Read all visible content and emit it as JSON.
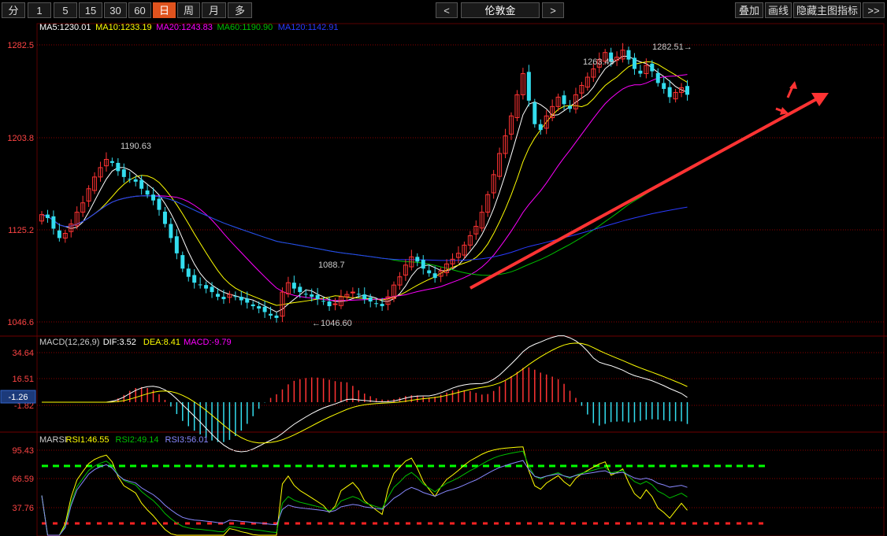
{
  "toolbar": {
    "periods": [
      "分",
      "1",
      "5",
      "15",
      "30",
      "60",
      "日",
      "周",
      "月",
      "多"
    ],
    "active_period": "日",
    "prev": "<",
    "symbol": "伦敦金",
    "next": ">",
    "overlay": "叠加",
    "draw_line": "画线",
    "hide_indicators": "隐藏主图指标",
    "more": ">>"
  },
  "main": {
    "legend": [
      {
        "text": "MA5:1230.01",
        "color": "#ffffff"
      },
      {
        "text": "MA10:1233.19",
        "color": "#ffff00"
      },
      {
        "text": "MA20:1243.83",
        "color": "#ff00ff"
      },
      {
        "text": "MA60:1190.90",
        "color": "#00c000"
      },
      {
        "text": "MA120:1142.91",
        "color": "#2a3bff"
      }
    ],
    "y_ticks": [
      "1282.5",
      "1203.8",
      "1125.2",
      "1046.6"
    ],
    "annotations": {
      "high1": "1190.63",
      "low1": "1088.7",
      "low2": "1046.60",
      "high2": "1263.49",
      "high3": "1282.51"
    }
  },
  "macd": {
    "legend": [
      {
        "text": "MACD(12,26,9)",
        "color": "#cccccc"
      },
      {
        "text": "DIF:3.52",
        "color": "#ffffff"
      },
      {
        "text": "DEA:8.41",
        "color": "#ffff00"
      },
      {
        "text": "MACD:-9.79",
        "color": "#ff00ff"
      }
    ],
    "y_ticks": [
      "34.64",
      "16.51",
      "-1.82"
    ],
    "current": "-1.26"
  },
  "rsi": {
    "legend": [
      {
        "text": "MARSI",
        "color": "#cccccc"
      },
      {
        "text": "RSI1:46.55",
        "color": "#ffff00"
      },
      {
        "text": "RSI2:49.14",
        "color": "#00c000"
      },
      {
        "text": "RSI3:56.01",
        "color": "#8888ff"
      }
    ],
    "y_ticks": [
      "95.43",
      "66.59",
      "37.76"
    ]
  },
  "colors": {
    "up": "#ff3333",
    "down": "#33ddee",
    "grid": "#8b0000",
    "arrow": "#ff3333"
  }
}
